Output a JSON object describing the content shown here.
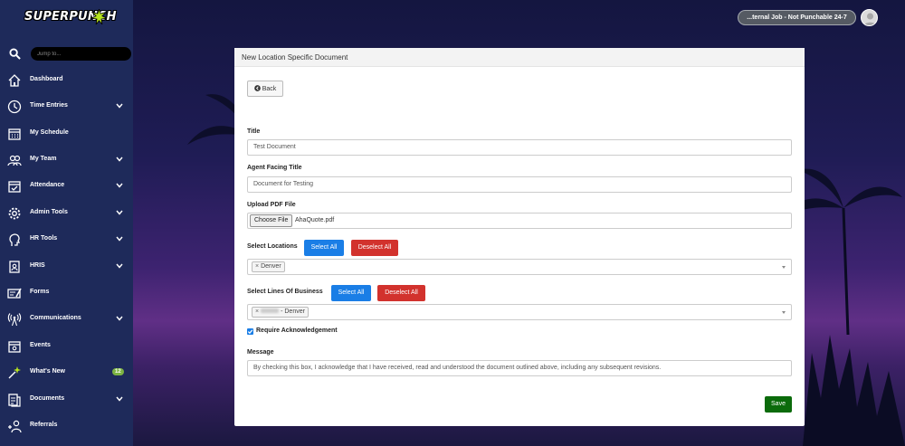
{
  "app": {
    "logo_text": "SUPERPUNCH"
  },
  "search": {
    "placeholder": "Jump to..."
  },
  "sidebar": {
    "items": [
      {
        "label": "Dashboard",
        "icon": "home-icon"
      },
      {
        "label": "Time Entries",
        "icon": "clock-icon"
      },
      {
        "label": "My Schedule",
        "icon": "calendar-icon"
      },
      {
        "label": "My Team",
        "icon": "team-icon"
      },
      {
        "label": "Attendance",
        "icon": "calendar-check-icon"
      },
      {
        "label": "Admin Tools",
        "icon": "gear-icon"
      },
      {
        "label": "HR Tools",
        "icon": "head-icon"
      },
      {
        "label": "HRIS",
        "icon": "badge-icon"
      },
      {
        "label": "Forms",
        "icon": "form-icon"
      },
      {
        "label": "Communications",
        "icon": "broadcast-icon"
      },
      {
        "label": "Events",
        "icon": "event-icon"
      },
      {
        "label": "What's New",
        "icon": "sparkle-icon",
        "badge": "12"
      },
      {
        "label": "Documents",
        "icon": "documents-icon"
      },
      {
        "label": "Referrals",
        "icon": "add-user-icon"
      }
    ]
  },
  "header": {
    "job_status": "...ternal Job - Not Punchable 24-7"
  },
  "card": {
    "title": "New Location Specific Document",
    "back_label": "Back",
    "title_label": "Title",
    "title_value": "Test Document",
    "agent_title_label": "Agent Facing Title",
    "agent_title_value": "Document for Testing",
    "upload_label": "Upload PDF File",
    "choose_file_label": "Choose File",
    "file_name": "AhaQuote.pdf",
    "locations_label": "Select Locations",
    "select_all_label": "Select All",
    "deselect_all_label": "Deselect All",
    "location_tag": "Denver",
    "lob_label": "Select Lines Of Business",
    "lob_tag": "- Denver",
    "ack_label": "Require Acknowledgement",
    "message_label": "Message",
    "message_value": "By checking this box, I acknowledge that I have received, read and understood the document outlined above, including any subsequent revisions.",
    "save_label": "Save"
  },
  "colors": {
    "sidebar_bg": "#1e2a5a",
    "primary": "#1a7ee6",
    "danger": "#d2322d",
    "success": "#0b6b0b",
    "badge": "#7cb342"
  }
}
